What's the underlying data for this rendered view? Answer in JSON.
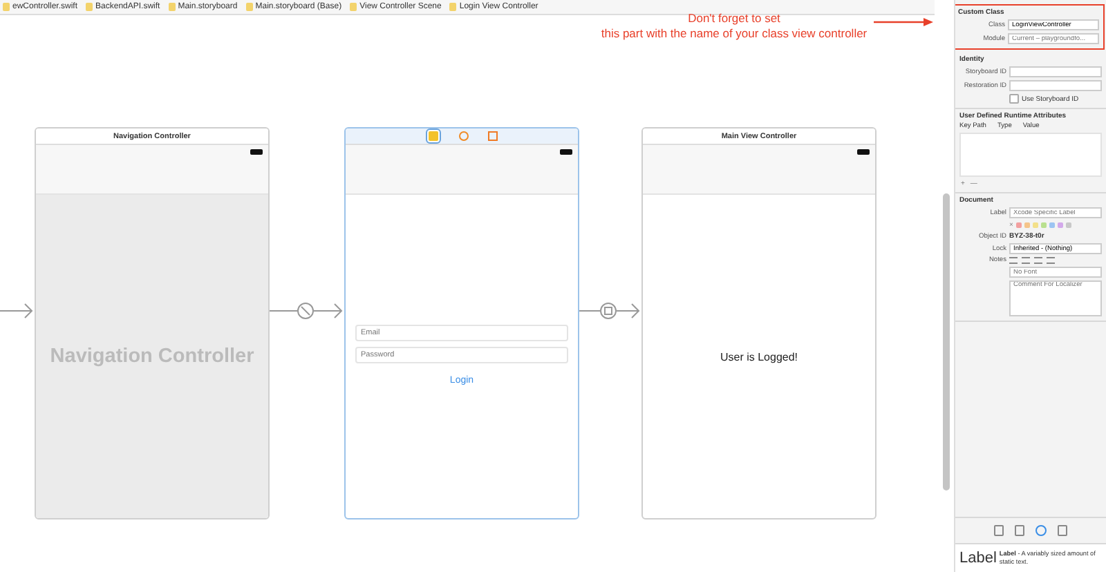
{
  "breadcrumb": [
    "ewController.swift",
    "BackendAPI.swift",
    "Main.storyboard",
    "Main.storyboard (Base)",
    "View Controller Scene",
    "Login View Controller"
  ],
  "annotation": {
    "lines": [
      "Don't forget to set",
      "this part with the name of your class view controller"
    ]
  },
  "scenes": [
    {
      "kind": "navigation",
      "title": "Navigation Controller",
      "center_label": "Navigation Controller",
      "selected": false
    },
    {
      "kind": "login",
      "selected": true,
      "fields": [
        {
          "placeholder": "Email"
        },
        {
          "placeholder": "Password"
        }
      ],
      "button": "Login"
    },
    {
      "kind": "main",
      "title": "Main View Controller",
      "center_label": "User is Logged!",
      "selected": false
    }
  ],
  "inspector": {
    "custom_class": {
      "heading": "Custom Class",
      "class_label": "Class",
      "class_value": "LoginViewController",
      "module_label": "Module",
      "module_placeholder": "Current – playgroundfo..."
    },
    "identity": {
      "heading": "Identity",
      "storyboard_id_label": "Storyboard ID",
      "restoration_id_label": "Restoration ID",
      "use_storyboard_id": {
        "label": "Use Storyboard ID",
        "checked": false
      }
    },
    "runtime_attributes": {
      "heading": "User Defined Runtime Attributes",
      "columns": [
        "Key Path",
        "Type",
        "Value"
      ],
      "add": "+",
      "remove": "—"
    },
    "document": {
      "heading": "Document",
      "label_label": "Label",
      "label_placeholder": "Xcode Specific Label",
      "clear": "×",
      "colors": [
        {
          "color": "#f2a0a0"
        },
        {
          "color": "#f5c48a"
        },
        {
          "color": "#f3e08a"
        },
        {
          "color": "#b9e08f"
        },
        {
          "color": "#9cc4f2"
        },
        {
          "color": "#d3a9ea"
        },
        {
          "color": "#c8c8c8"
        }
      ],
      "object_id_label": "Object ID",
      "object_id": "BYZ-38-t0r",
      "lock_label": "Lock",
      "lock_value": "Inherited - (Nothing)",
      "notes_label": "Notes",
      "font_placeholder": "No Font",
      "comment_placeholder": "Comment For Localizer"
    },
    "library_tabs": [
      {
        "selected": false
      },
      {
        "selected": false
      },
      {
        "selected": true
      },
      {
        "selected": false
      }
    ],
    "library_item": {
      "title": "Label",
      "description": "**Label** - A variably sized amount of static text."
    }
  }
}
